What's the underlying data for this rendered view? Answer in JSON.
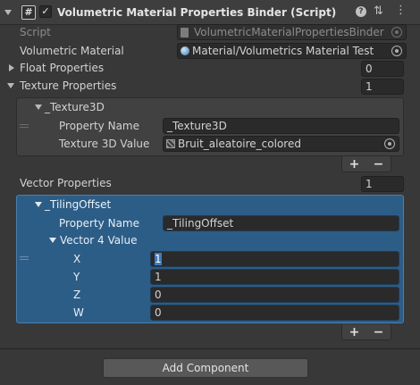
{
  "header": {
    "title": "Volumetric Material Properties Binder (Script)",
    "script_icon_glyph": "#",
    "enabled": true
  },
  "script_row": {
    "label": "Script",
    "value": "VolumetricMaterialPropertiesBinder"
  },
  "material_row": {
    "label": "Volumetric Material",
    "value": "Material/Volumetrics Material Test"
  },
  "float_props": {
    "label": "Float Properties",
    "count": "0"
  },
  "texture_props": {
    "label": "Texture Properties",
    "count": "1",
    "element": {
      "title": "_Texture3D",
      "property_name_label": "Property Name",
      "property_name_value": "_Texture3D",
      "value_label": "Texture 3D Value",
      "value": "Bruit_aleatoire_colored"
    }
  },
  "vector_props": {
    "label": "Vector Properties",
    "count": "1",
    "element": {
      "title": "_TilingOffset",
      "property_name_label": "Property Name",
      "property_name_value": "_TilingOffset",
      "vector_label": "Vector 4 Value",
      "components": [
        {
          "label": "X",
          "value": "1"
        },
        {
          "label": "Y",
          "value": "1"
        },
        {
          "label": "Z",
          "value": "0"
        },
        {
          "label": "W",
          "value": "0"
        }
      ]
    }
  },
  "list_buttons": {
    "plus": "+",
    "minus": "−"
  },
  "add_component": "Add Component",
  "colors": {
    "background": "#383838",
    "header": "#3e3e3e",
    "selection": "#2c5d87",
    "field": "#2a2a2a",
    "text": "#d2d2d2"
  }
}
